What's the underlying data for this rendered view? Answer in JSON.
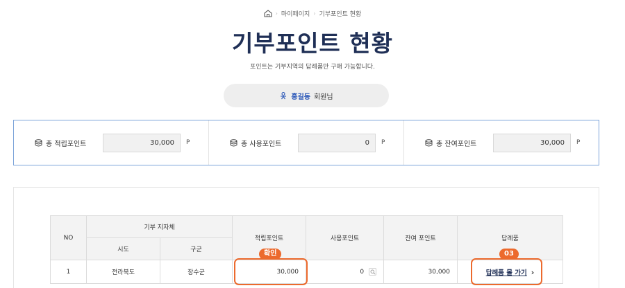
{
  "breadcrumb": {
    "items": [
      "마이페이지",
      "기부포인트 현황"
    ]
  },
  "page": {
    "title": "기부포인트 현황",
    "subtitle": "포인트는 기부지역의 답례품만 구매 가능합니다."
  },
  "user": {
    "name": "홍길동",
    "suffix": "회원님"
  },
  "summary": [
    {
      "label": "총 적립포인트",
      "value": "30,000",
      "unit": "P"
    },
    {
      "label": "총 사용포인트",
      "value": "0",
      "unit": "P"
    },
    {
      "label": "총 잔여포인트",
      "value": "30,000",
      "unit": "P"
    }
  ],
  "table": {
    "headers": {
      "no": "NO",
      "region_group": "기부 지자체",
      "sido": "시도",
      "gugun": "구군",
      "earned": "적립포인트",
      "used": "사용포인트",
      "remaining": "잔여 포인트",
      "gift": "답례품"
    },
    "rows": [
      {
        "no": "1",
        "sido": "전라북도",
        "gugun": "장수군",
        "earned": "30,000",
        "used": "0",
        "remaining": "30,000",
        "gift_link": "답례품 몰 가기"
      }
    ]
  },
  "annotations": {
    "confirm_badge": "확인",
    "step_badge": "03",
    "color": "#ec6a2d"
  },
  "colors": {
    "title": "#1f2f56",
    "accent_blue": "#2a57b8",
    "summary_border": "#7aa2d9"
  }
}
